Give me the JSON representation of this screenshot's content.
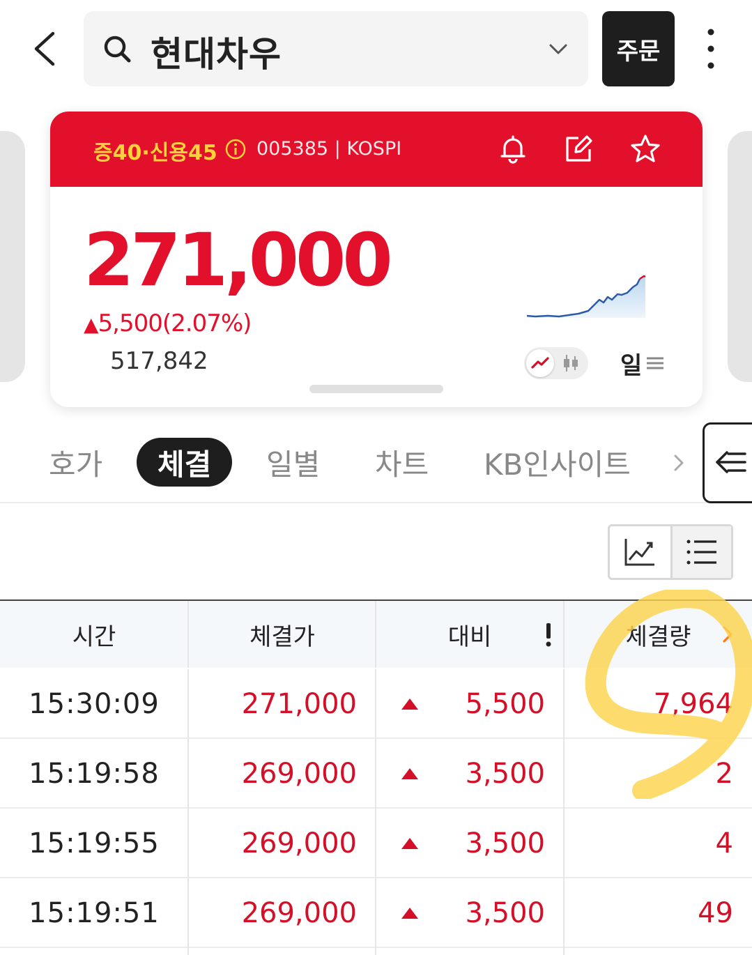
{
  "search": {
    "value": "현대차우"
  },
  "order_button": {
    "label": "주문"
  },
  "stock": {
    "margin_info": "증40·신용45",
    "code_market": "005385 | KOSPI",
    "price": "271,000",
    "change_arrow": "▲",
    "change": "5,500(2.07%)",
    "volume": "517,842",
    "period": "일",
    "header_color": "#e3102c"
  },
  "icons": {
    "header": [
      "bell-icon",
      "edit-icon",
      "star-icon"
    ],
    "info": "info-icon",
    "more": "more-vertical-icon"
  },
  "tabs": [
    {
      "label": "호가",
      "active": false
    },
    {
      "label": "체결",
      "active": true
    },
    {
      "label": "일별",
      "active": false
    },
    {
      "label": "차트",
      "active": false
    },
    {
      "label": "KB인사이트",
      "active": false
    }
  ],
  "table": {
    "headers": [
      "시간",
      "체결가",
      "대비",
      "체결량"
    ],
    "rows": [
      {
        "time": "15:30:09",
        "price": "271,000",
        "diff": "5,500",
        "volume": "7,964"
      },
      {
        "time": "15:19:58",
        "price": "269,000",
        "diff": "3,500",
        "volume": "2"
      },
      {
        "time": "15:19:55",
        "price": "269,000",
        "diff": "3,500",
        "volume": "4"
      },
      {
        "time": "15:19:51",
        "price": "269,000",
        "diff": "3,500",
        "volume": "49"
      }
    ]
  },
  "colors": {
    "up": "#d31027",
    "highlight_marker": "#fcd34d"
  }
}
